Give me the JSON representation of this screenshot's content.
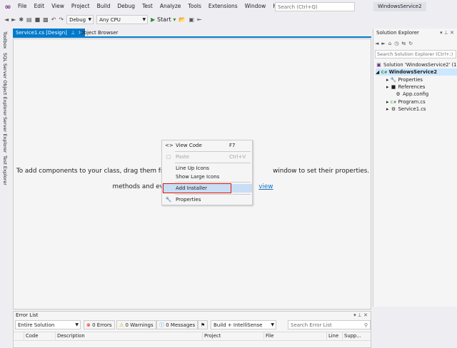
{
  "menu": [
    "File",
    "Edit",
    "View",
    "Project",
    "Build",
    "Debug",
    "Test",
    "Analyze",
    "Tools",
    "Extensions",
    "Window",
    "Help"
  ],
  "search_placeholder": "Search (Ctrl+Q)",
  "solution_name": "WindowsService2",
  "toolbar": {
    "config": "Debug",
    "platform": "Any CPU",
    "start": "Start"
  },
  "left_tabs": [
    "Toolbox",
    "SQL Server Object Explorer",
    "Server Explorer",
    "Test Explorer"
  ],
  "tabs": {
    "active": "Service1.cs [Design]",
    "inactive": "Object Browser"
  },
  "designer": {
    "hint_line1": "To add components to your class, drag them from th",
    "hint_line1_end": "window to set their properties. To create",
    "hint_line2": "methods and eve",
    "hint_link": "view"
  },
  "context_menu": [
    {
      "icon": "<>",
      "label": "View Code",
      "shortcut": "F7",
      "disabled": false
    },
    {
      "icon": "▢",
      "label": "Paste",
      "shortcut": "Ctrl+V",
      "disabled": true
    },
    {
      "icon": "",
      "label": "Line Up Icons",
      "shortcut": "",
      "disabled": false
    },
    {
      "icon": "",
      "label": "Show Large Icons",
      "shortcut": "",
      "disabled": false
    },
    {
      "icon": "",
      "label": "Add Installer",
      "shortcut": "",
      "disabled": false
    },
    {
      "icon": "🔧",
      "label": "Properties",
      "shortcut": "",
      "disabled": false
    }
  ],
  "solution_explorer": {
    "title": "Solution Explorer",
    "search": "Search Solution Explorer (Ctrl+;)",
    "tree": [
      {
        "label": "Solution 'WindowsService2' (1 c",
        "icon": "▣"
      },
      {
        "label": "WindowsService2",
        "icon": "C#"
      },
      {
        "label": "Properties",
        "icon": "🔧"
      },
      {
        "label": "References",
        "icon": "■"
      },
      {
        "label": "App.config",
        "icon": "⚙"
      },
      {
        "label": "Program.cs",
        "icon": "C#"
      },
      {
        "label": "Service1.cs",
        "icon": "⚙"
      }
    ]
  },
  "error_list": {
    "title": "Error List",
    "scope": "Entire Solution",
    "errors": "0 Errors",
    "warnings": "0 Warnings",
    "messages": "0 Messages",
    "build_filter": "Build + IntelliSense",
    "search": "Search Error List",
    "columns": [
      "Code",
      "Description",
      "Project",
      "File",
      "Line",
      "Supp..."
    ]
  }
}
